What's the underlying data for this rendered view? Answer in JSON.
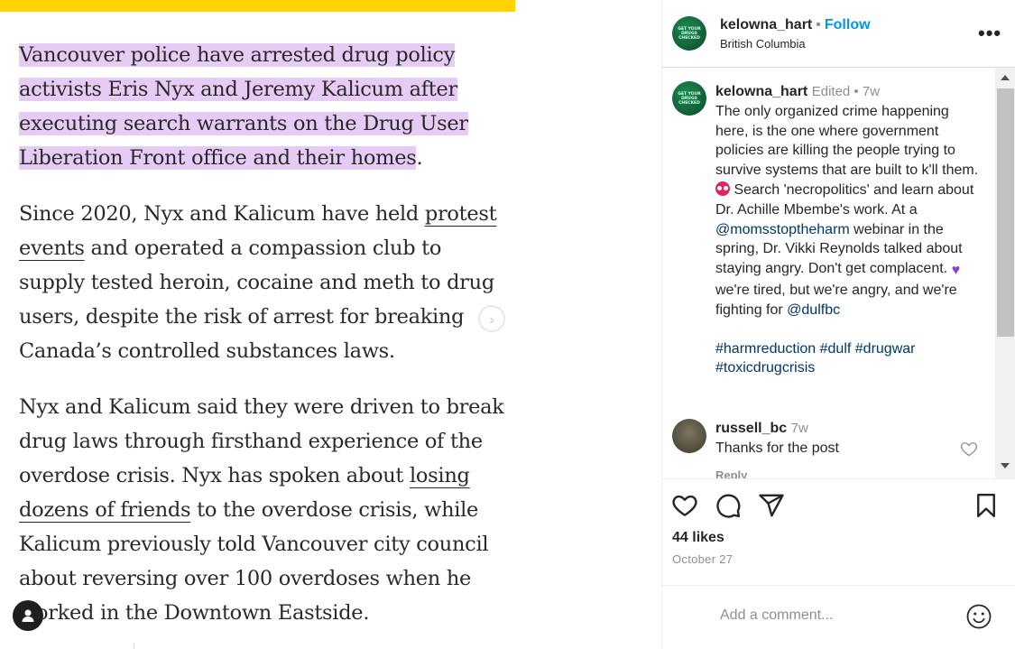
{
  "article": {
    "p1_highlight": "Vancouver police have arrested drug policy activists Eris Nyx and Jeremy Kalicum after executing search warrants on the Drug User Liberation Front office and their homes",
    "p1_tail": ".",
    "p2_a": "Since 2020, Nyx and Kalicum have held ",
    "p2_link": "protest events",
    "p2_b": " and operated a compassion club to supply tested heroin, cocaine and meth to drug users, despite the risk of arrest for breaking Canada’s controlled substances laws.",
    "p3_a": "Nyx and Kalicum said they were driven to break drug laws through firsthand experience of the overdose crisis. Nyx has spoken about ",
    "p3_link": "losing dozens of friends",
    "p3_b": " to the overdose crisis, while Kalicum previously told Vancouver city council about reversing over 100 overdoses when he worked in the Downtown Eastside.",
    "next_icon": "chevron-right-icon",
    "user_icon": "user-icon"
  },
  "post": {
    "username": "kelowna_hart",
    "follow_label": "Follow",
    "location": "British Columbia",
    "avatar_text": "GET YOUR DRUGS CHECKED",
    "caption_meta_edited": "Edited",
    "caption_meta_time": "7w",
    "caption_1": "The only organized crime happening here, is the one where government policies are killing the people trying to survive systems that are built to k'll them. ",
    "caption_2": " Search 'necropolitics' and learn about Dr. Achille Mbembe's work. At a ",
    "mention_1": "@momsstoptheharm",
    "caption_3": " webinar in the spring, Dr. Vikki Reynolds talked about staying angry. Don't get complacent. ",
    "caption_4": " we're tired, but we're angry, and we're fighting for ",
    "mention_2": "@dulfbc",
    "hashtags": [
      "#harmreduction",
      "#dulf",
      "#drugwar",
      "#toxicdrugcrisis"
    ],
    "reply": {
      "username": "russell_bc",
      "time": "7w",
      "text": "Thanks for the post",
      "reply_label": "Reply"
    },
    "likes": "44 likes",
    "date": "October 27",
    "add_comment_placeholder": "Add a comment...",
    "colors": {
      "follow": "#0095f6",
      "mention": "#00376b",
      "highlight": "#e6ccf5",
      "top_bar": "#ffd400"
    }
  }
}
